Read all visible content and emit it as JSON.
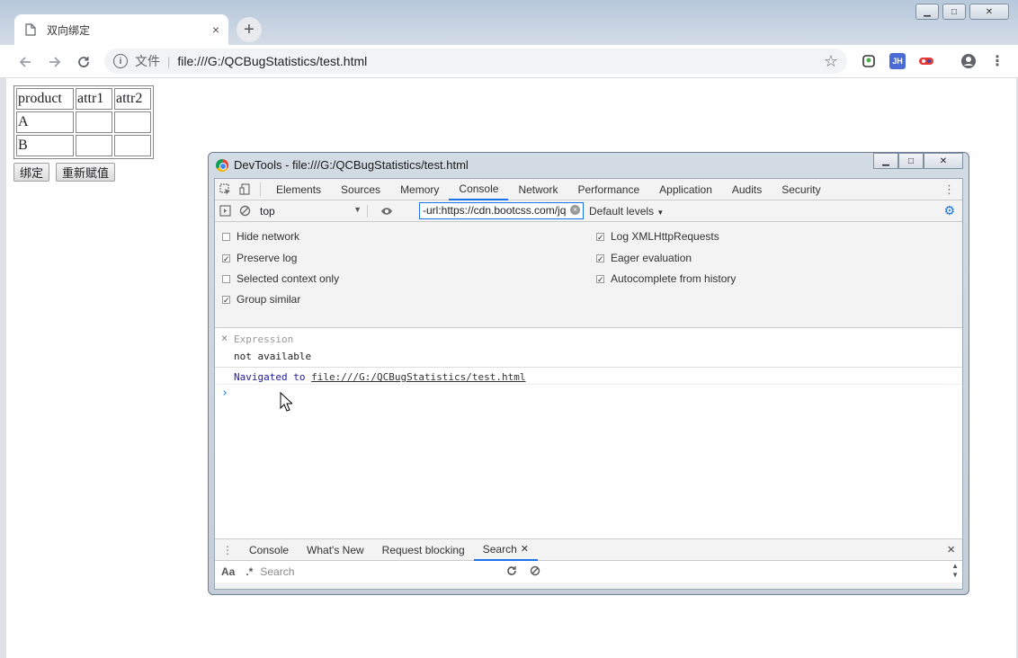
{
  "browser": {
    "tab_title": "双向绑定",
    "tab_close": "×",
    "new_tab": "+",
    "omnibox": {
      "info_icon": "i",
      "protocol_label": "文件",
      "separator": "|",
      "url": "file:///G:/QCBugStatistics/test.html"
    },
    "extensions": [
      "JH"
    ]
  },
  "page": {
    "table": {
      "header": [
        "product",
        "attr1",
        "attr2"
      ],
      "rows": [
        [
          "A",
          "",
          ""
        ],
        [
          "B",
          "",
          ""
        ]
      ]
    },
    "buttons": {
      "bind": "绑定",
      "reassign": "重新赋值"
    }
  },
  "devtools": {
    "title": "DevTools - file:///G:/QCBugStatistics/test.html",
    "tabs": [
      "Elements",
      "Sources",
      "Memory",
      "Console",
      "Network",
      "Performance",
      "Application",
      "Audits",
      "Security"
    ],
    "active_tab": "Console",
    "context": "top",
    "filter_value": "-url:https://cdn.bootcss.com/jq",
    "levels": "Default levels",
    "settings": {
      "left": [
        {
          "label": "Hide network",
          "checked": false
        },
        {
          "label": "Preserve log",
          "checked": true
        },
        {
          "label": "Selected context only",
          "checked": false
        },
        {
          "label": "Group similar",
          "checked": true
        }
      ],
      "right": [
        {
          "label": "Log XMLHttpRequests",
          "checked": true
        },
        {
          "label": "Eager evaluation",
          "checked": true
        },
        {
          "label": "Autocomplete from history",
          "checked": true
        }
      ]
    },
    "expression": {
      "placeholder": "Expression",
      "value": "not available",
      "close": "×"
    },
    "console": {
      "navigated_prefix": "Navigated to",
      "navigated_link": "file:///G:/QCBugStatistics/test.html",
      "prompt": "›"
    },
    "drawer": {
      "tabs": [
        "Console",
        "What's New",
        "Request blocking",
        "Search"
      ],
      "active_tab": "Search",
      "search_case": "Aa",
      "search_regex": ".*",
      "search_placeholder": "Search",
      "close": "×"
    }
  },
  "colors": {
    "accent": "#1a73e8",
    "link_blue": "#1a1aa6"
  }
}
